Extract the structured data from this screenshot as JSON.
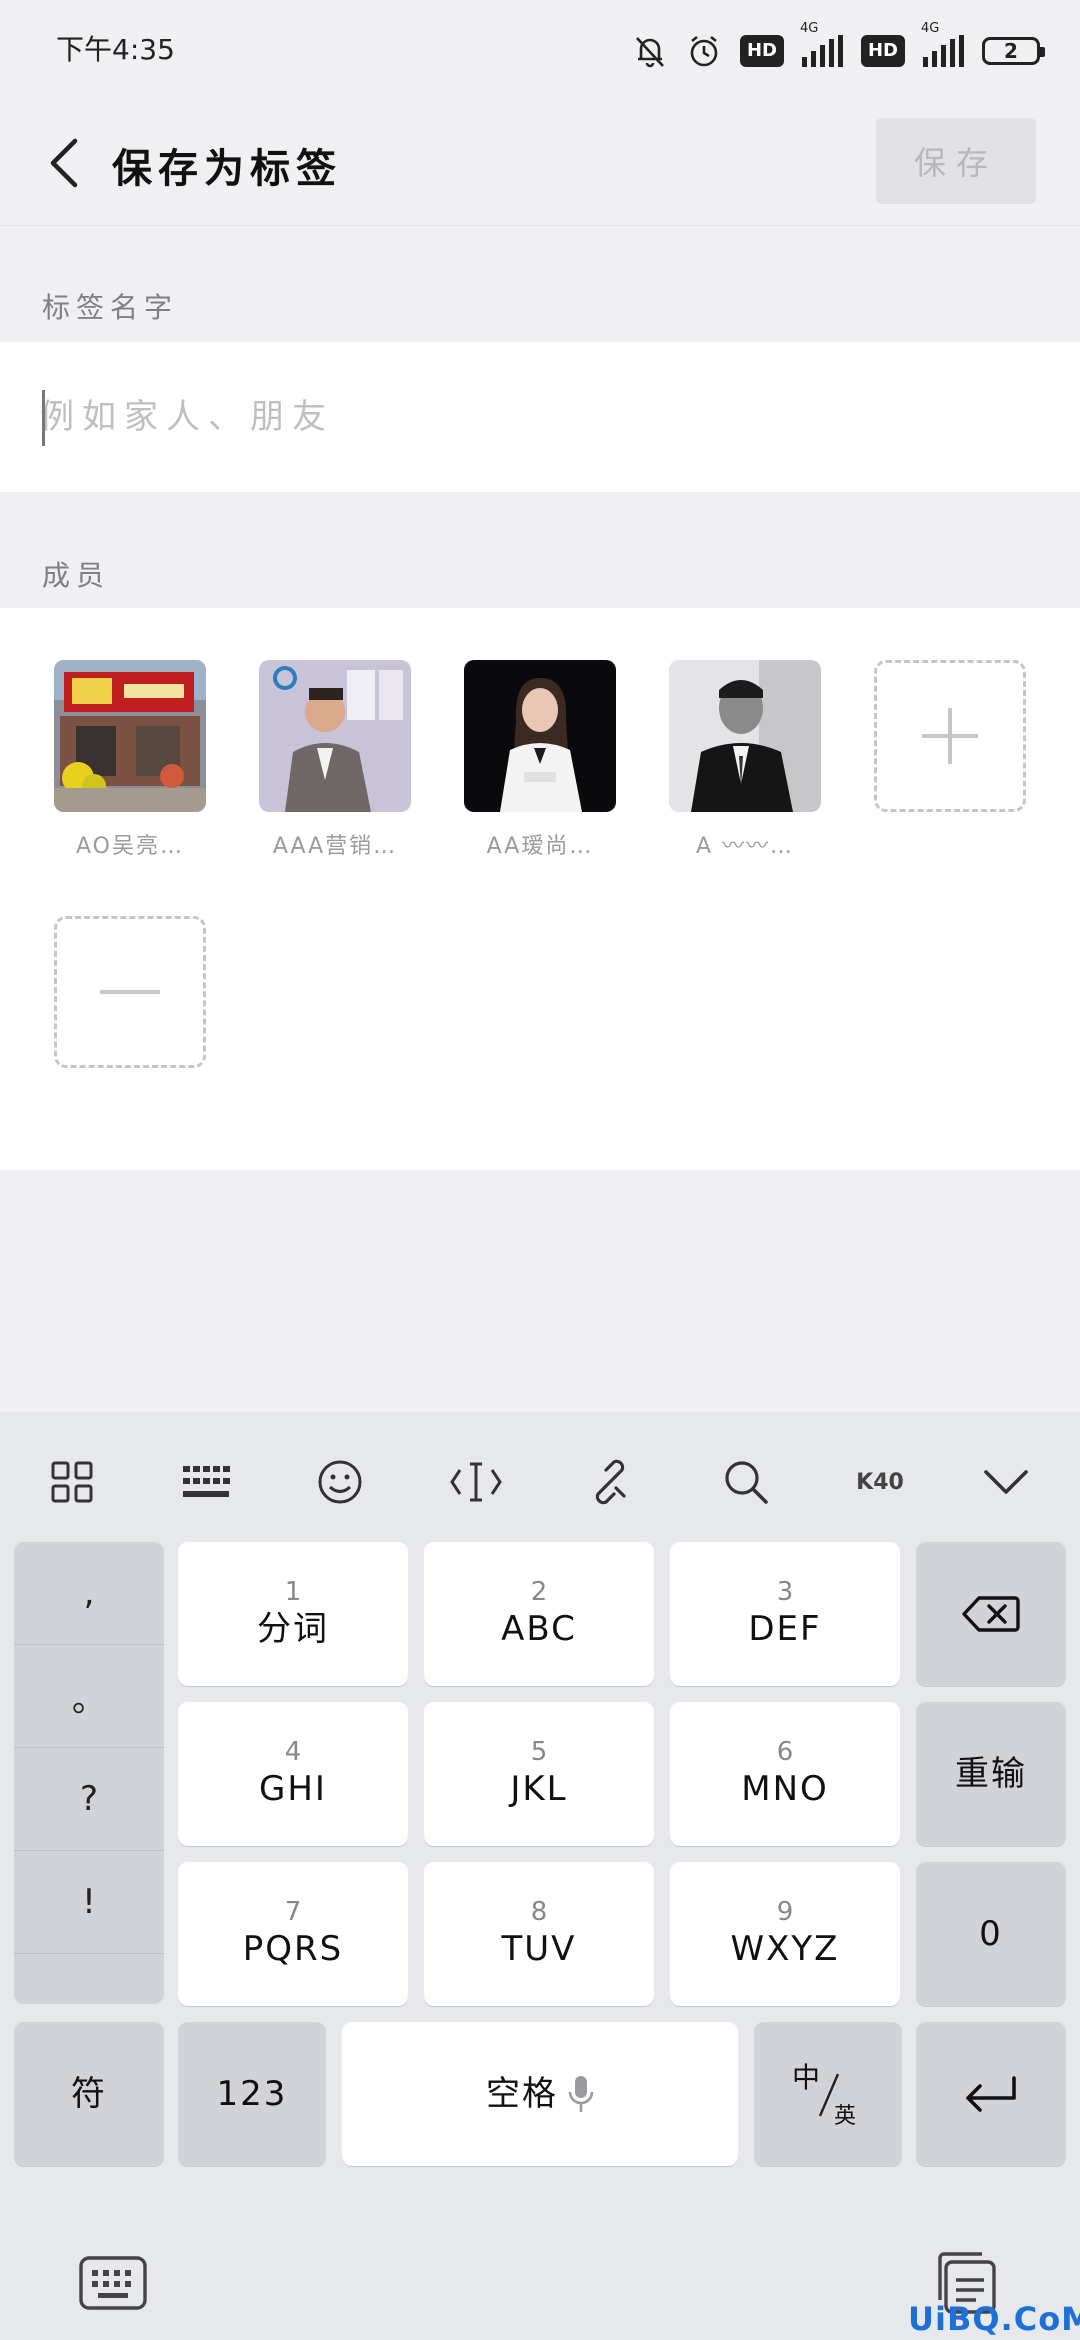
{
  "status_bar": {
    "time": "下午4:35",
    "hd1": "HD",
    "hd2": "HD",
    "net1": "4G",
    "net2": "4G",
    "battery": "2"
  },
  "header": {
    "title": "保存为标签",
    "save_label": "保存"
  },
  "label_name": {
    "section_title": "标签名字",
    "placeholder": "例如家人、朋友"
  },
  "members": {
    "section_title": "成员",
    "items": [
      {
        "name": "AO吴亮…"
      },
      {
        "name": "AAA营销…"
      },
      {
        "name": "AA瑷尚…"
      },
      {
        "name": "A 〰〰…"
      }
    ]
  },
  "keyboard": {
    "toolbar": {
      "k40_label": "K40"
    },
    "punctuation": [
      ",",
      "。",
      "?",
      "!"
    ],
    "keys": [
      {
        "num": "1",
        "label": "分词"
      },
      {
        "num": "2",
        "label": "ABC"
      },
      {
        "num": "3",
        "label": "DEF"
      },
      {
        "num": "4",
        "label": "GHI"
      },
      {
        "num": "5",
        "label": "JKL"
      },
      {
        "num": "6",
        "label": "MNO"
      },
      {
        "num": "7",
        "label": "PQRS"
      },
      {
        "num": "8",
        "label": "TUV"
      },
      {
        "num": "9",
        "label": "WXYZ"
      }
    ],
    "reenter_label": "重输",
    "zero_label": "0",
    "symbol_label": "符",
    "num_switch_label": "123",
    "space_label": "空格",
    "lang_zh": "中",
    "lang_en": "英"
  },
  "watermark": "UiBQ.CoM",
  "colors": {
    "watermark": "#1e6fd6",
    "save_disabled_bg": "#e2e2e4",
    "keyboard_bg": "#e7e8ec"
  }
}
